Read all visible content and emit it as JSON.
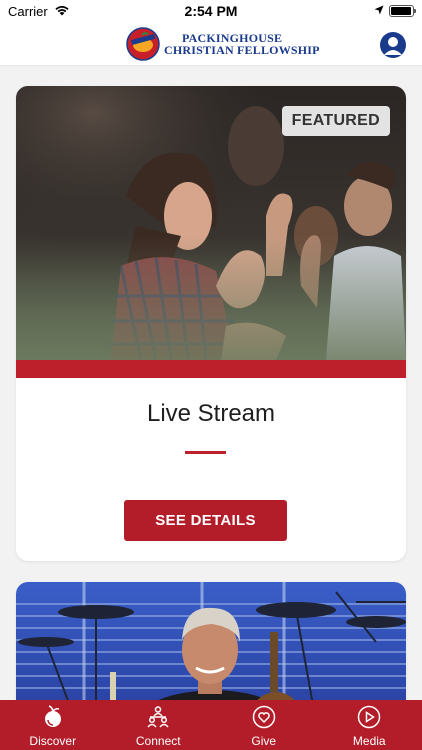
{
  "status_bar": {
    "carrier": "Carrier",
    "time": "2:54 PM"
  },
  "header": {
    "logo_line1": "PACKINGHOUSE",
    "logo_line2": "CHRISTIAN FELLOWSHIP",
    "profile_icon": "person-circle-icon"
  },
  "featured_card": {
    "badge": "FEATURED",
    "title": "Live Stream",
    "button_label": "SEE DETAILS"
  },
  "tabs": [
    {
      "label": "Discover",
      "icon": "discover-icon"
    },
    {
      "label": "Connect",
      "icon": "people-icon"
    },
    {
      "label": "Give",
      "icon": "heart-icon"
    },
    {
      "label": "Media",
      "icon": "play-icon"
    }
  ],
  "colors": {
    "accent": "#b31d29",
    "brand_blue": "#1a3b8c",
    "background": "#f2f2f2"
  }
}
